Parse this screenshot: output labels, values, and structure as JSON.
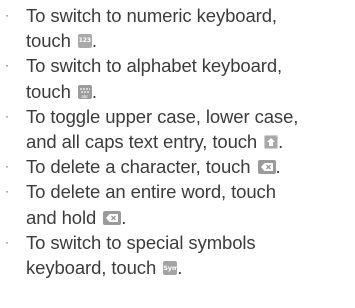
{
  "items": [
    {
      "line1": "To switch to numeric keyboard,",
      "line2": "touch",
      "tail": ".",
      "icon": "numeric-keyboard-icon",
      "icon_text": "123"
    },
    {
      "line1": "To switch to alphabet keyboard,",
      "line2": "touch",
      "tail": ".",
      "icon": "alphabet-keyboard-icon",
      "icon_text": "abc"
    },
    {
      "line1": "To toggle upper case, lower case,",
      "line2": "and all caps text entry, touch",
      "tail": ".",
      "icon": "shift-icon"
    },
    {
      "line1": "To delete a character, touch",
      "tail": ".",
      "icon": "delete-icon"
    },
    {
      "line1": "To delete an entire word, touch",
      "line2": "and hold",
      "tail": ".",
      "icon": "delete-icon"
    },
    {
      "line1": "To switch to special symbols",
      "line2": "keyboard, touch",
      "tail": ".",
      "icon": "symbols-keyboard-icon",
      "icon_text": "Sym"
    }
  ],
  "bullet": "·"
}
